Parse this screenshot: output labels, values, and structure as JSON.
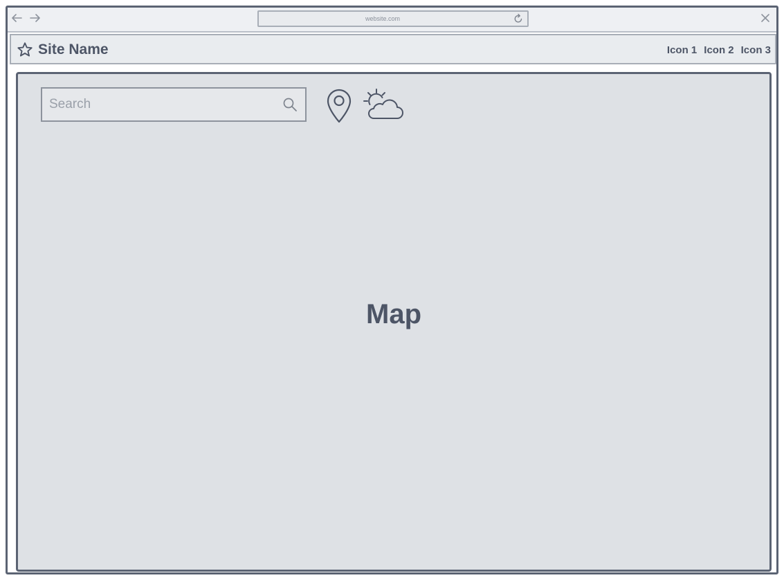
{
  "browser": {
    "url": "website.com",
    "back_icon": "arrow-left-icon",
    "forward_icon": "arrow-right-icon",
    "reload_icon": "reload-icon",
    "close_icon": "close-icon"
  },
  "header": {
    "site_name": "Site Name",
    "brand_icon": "star-icon",
    "links": [
      "Icon 1",
      "Icon 2",
      "Icon 3"
    ]
  },
  "map": {
    "search_placeholder": "Search",
    "search_value": "",
    "label": "Map",
    "icons": [
      "search-icon",
      "location-pin-icon",
      "weather-icon"
    ]
  },
  "colors": {
    "stroke": "#5b6373",
    "text": "#4d5566",
    "map_fill": "#dee1e5",
    "chrome_fill": "#eef0f3"
  }
}
